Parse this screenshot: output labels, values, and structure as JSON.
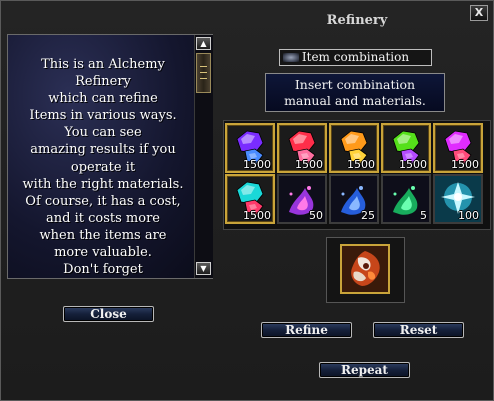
{
  "window": {
    "title": "Refinery",
    "close_glyph": "X"
  },
  "description": {
    "lines": [
      "This is an Alchemy",
      "Refinery",
      "which can refine",
      "Items in various ways.",
      "You can see",
      "amazing results if you",
      "operate it",
      "with the right materials.",
      "Of course, it has a cost,",
      "and it costs more",
      "when the items are",
      "more valuable.",
      "Don't forget"
    ]
  },
  "scrollbar": {
    "up_glyph": "▲",
    "down_glyph": "▼"
  },
  "buttons": {
    "close": "Close",
    "refine": "Refine",
    "reset": "Reset",
    "repeat": "Repeat"
  },
  "right": {
    "item_combination": "Item combination",
    "insert_line1": "Insert combination",
    "insert_line2": "manual and materials."
  },
  "slots": [
    {
      "icon": "purple-gem-icon",
      "qty": "1500",
      "colors": [
        "#7a2cff",
        "#4a8cff"
      ]
    },
    {
      "icon": "red-gem-icon",
      "qty": "1500",
      "colors": [
        "#ff2e4a",
        "#ff6fa0"
      ]
    },
    {
      "icon": "orange-gem-icon",
      "qty": "1500",
      "colors": [
        "#ff9a1a",
        "#ffd23a"
      ]
    },
    {
      "icon": "green-gem-icon",
      "qty": "1500",
      "colors": [
        "#55e01a",
        "#b44bff"
      ]
    },
    {
      "icon": "magenta-gem-icon",
      "qty": "1500",
      "colors": [
        "#e02cff",
        "#ff4a7a"
      ]
    },
    {
      "icon": "teal-gem-icon",
      "qty": "1500",
      "colors": [
        "#1ad8d8",
        "#ff3a6a"
      ]
    },
    {
      "icon": "purple-essence-icon",
      "qty": "50",
      "colors": [
        "#b03cff",
        "#ff7ae8"
      ]
    },
    {
      "icon": "blue-essence-icon",
      "qty": "25",
      "colors": [
        "#2a6cff",
        "#8ab8ff"
      ]
    },
    {
      "icon": "green-essence-icon",
      "qty": "5",
      "colors": [
        "#1ac86a",
        "#6affb0"
      ]
    },
    {
      "icon": "cyan-crystal-icon",
      "qty": "100",
      "colors": [
        "#3adcff",
        "#c8f8ff"
      ]
    }
  ],
  "result": {
    "icon": "refinery-result-icon"
  }
}
